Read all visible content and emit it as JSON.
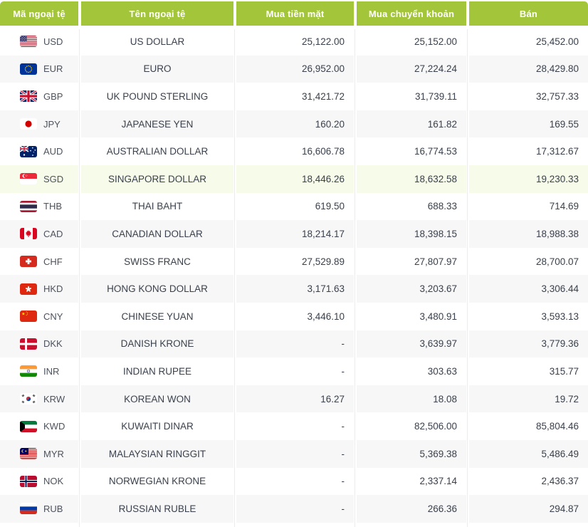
{
  "colors": {
    "header_bg": "#a3c53a",
    "header_text": "#ffffff",
    "row_alt_bg": "#f7f7f7",
    "row_highlight_bg": "#f7fbe9",
    "text": "#3a414c"
  },
  "table": {
    "headers": [
      "Mã ngoại tệ",
      "Tên ngoại tệ",
      "Mua tiền mặt",
      "Mua chuyển khoản",
      "Bán"
    ],
    "rows": [
      {
        "code": "USD",
        "flag_icon": "flag-usd-icon",
        "name": "US DOLLAR",
        "buy_cash": "25,122.00",
        "buy_transfer": "25,152.00",
        "sell": "25,452.00",
        "highlighted": false
      },
      {
        "code": "EUR",
        "flag_icon": "flag-eur-icon",
        "name": "EURO",
        "buy_cash": "26,952.00",
        "buy_transfer": "27,224.24",
        "sell": "28,429.80",
        "highlighted": false
      },
      {
        "code": "GBP",
        "flag_icon": "flag-gbp-icon",
        "name": "UK POUND STERLING",
        "buy_cash": "31,421.72",
        "buy_transfer": "31,739.11",
        "sell": "32,757.33",
        "highlighted": false
      },
      {
        "code": "JPY",
        "flag_icon": "flag-jpy-icon",
        "name": "JAPANESE YEN",
        "buy_cash": "160.20",
        "buy_transfer": "161.82",
        "sell": "169.55",
        "highlighted": false
      },
      {
        "code": "AUD",
        "flag_icon": "flag-aud-icon",
        "name": "AUSTRALIAN DOLLAR",
        "buy_cash": "16,606.78",
        "buy_transfer": "16,774.53",
        "sell": "17,312.67",
        "highlighted": false
      },
      {
        "code": "SGD",
        "flag_icon": "flag-sgd-icon",
        "name": "SINGAPORE DOLLAR",
        "buy_cash": "18,446.26",
        "buy_transfer": "18,632.58",
        "sell": "19,230.33",
        "highlighted": true
      },
      {
        "code": "THB",
        "flag_icon": "flag-thb-icon",
        "name": "THAI BAHT",
        "buy_cash": "619.50",
        "buy_transfer": "688.33",
        "sell": "714.69",
        "highlighted": false
      },
      {
        "code": "CAD",
        "flag_icon": "flag-cad-icon",
        "name": "CANADIAN DOLLAR",
        "buy_cash": "18,214.17",
        "buy_transfer": "18,398.15",
        "sell": "18,988.38",
        "highlighted": false
      },
      {
        "code": "CHF",
        "flag_icon": "flag-chf-icon",
        "name": "SWISS FRANC",
        "buy_cash": "27,529.89",
        "buy_transfer": "27,807.97",
        "sell": "28,700.07",
        "highlighted": false
      },
      {
        "code": "HKD",
        "flag_icon": "flag-hkd-icon",
        "name": "HONG KONG DOLLAR",
        "buy_cash": "3,171.63",
        "buy_transfer": "3,203.67",
        "sell": "3,306.44",
        "highlighted": false
      },
      {
        "code": "CNY",
        "flag_icon": "flag-cny-icon",
        "name": "CHINESE YUAN",
        "buy_cash": "3,446.10",
        "buy_transfer": "3,480.91",
        "sell": "3,593.13",
        "highlighted": false
      },
      {
        "code": "DKK",
        "flag_icon": "flag-dkk-icon",
        "name": "DANISH KRONE",
        "buy_cash": "-",
        "buy_transfer": "3,639.97",
        "sell": "3,779.36",
        "highlighted": false
      },
      {
        "code": "INR",
        "flag_icon": "flag-inr-icon",
        "name": "INDIAN RUPEE",
        "buy_cash": "-",
        "buy_transfer": "303.63",
        "sell": "315.77",
        "highlighted": false
      },
      {
        "code": "KRW",
        "flag_icon": "flag-krw-icon",
        "name": "KOREAN WON",
        "buy_cash": "16.27",
        "buy_transfer": "18.08",
        "sell": "19.72",
        "highlighted": false
      },
      {
        "code": "KWD",
        "flag_icon": "flag-kwd-icon",
        "name": "KUWAITI DINAR",
        "buy_cash": "-",
        "buy_transfer": "82,506.00",
        "sell": "85,804.46",
        "highlighted": false
      },
      {
        "code": "MYR",
        "flag_icon": "flag-myr-icon",
        "name": "MALAYSIAN RINGGIT",
        "buy_cash": "-",
        "buy_transfer": "5,369.38",
        "sell": "5,486.49",
        "highlighted": false
      },
      {
        "code": "NOK",
        "flag_icon": "flag-nok-icon",
        "name": "NORWEGIAN KRONE",
        "buy_cash": "-",
        "buy_transfer": "2,337.14",
        "sell": "2,436.37",
        "highlighted": false
      },
      {
        "code": "RUB",
        "flag_icon": "flag-rub-icon",
        "name": "RUSSIAN RUBLE",
        "buy_cash": "-",
        "buy_transfer": "266.36",
        "sell": "294.87",
        "highlighted": false
      }
    ]
  }
}
